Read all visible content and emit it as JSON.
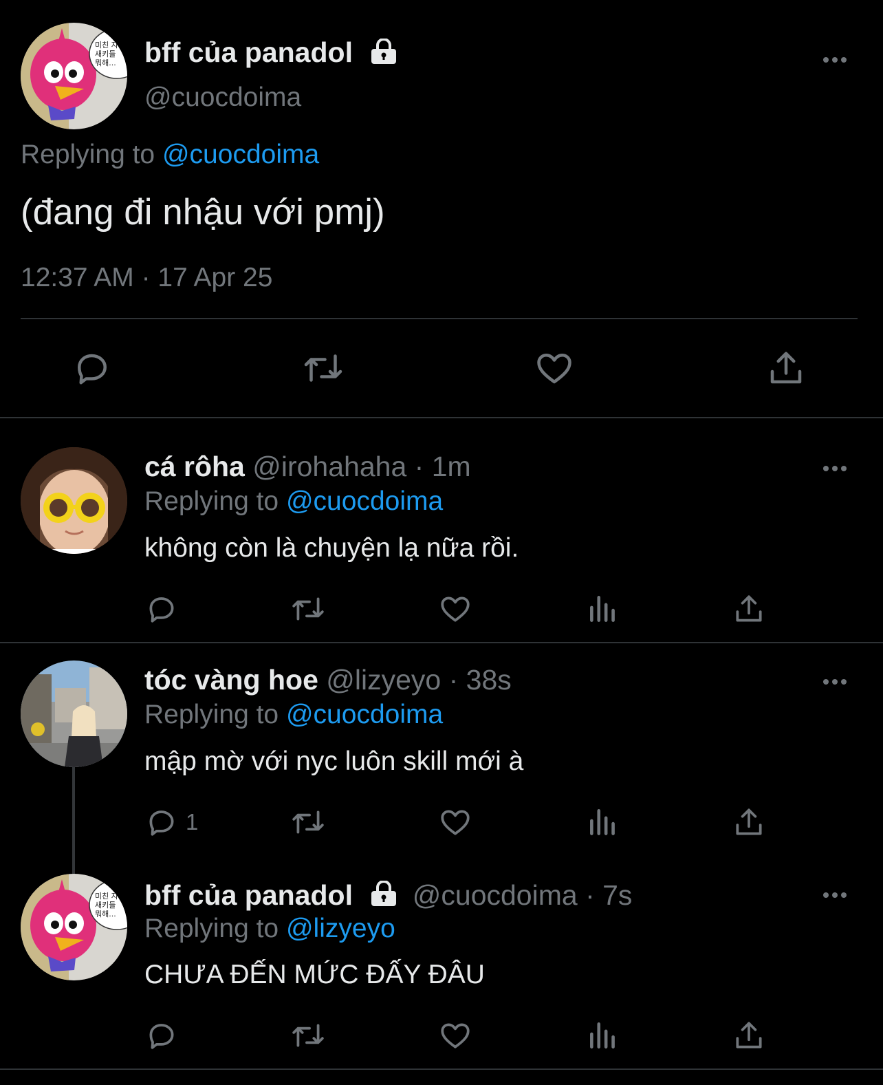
{
  "main_tweet": {
    "author_name": "bff của panadol",
    "author_handle": "@cuocdoima",
    "replying_prefix": "Replying to",
    "replying_to": "@cuocdoima",
    "text": "(đang đi nhậu với pmj)",
    "timestamp": "12:37 AM · 17 Apr 25",
    "avatar_speech_text": "미친 자\n새키들\n뭐해..."
  },
  "replies": [
    {
      "author_name": "cá rôha",
      "author_handle": "@irohahaha",
      "time": "1m",
      "replying_prefix": "Replying to",
      "replying_to": "@cuocdoima",
      "text": "không còn là chuyện lạ nữa rồi.",
      "reply_count": ""
    },
    {
      "author_name": "tóc vàng hoe",
      "author_handle": "@lizyeyo",
      "time": "38s",
      "replying_prefix": "Replying to",
      "replying_to": "@cuocdoima",
      "text": "mập mờ với nyc luôn skill mới à",
      "reply_count": "1"
    },
    {
      "author_name": "bff của panadol",
      "author_handle": "@cuocdoima",
      "time": "7s",
      "replying_prefix": "Replying to",
      "replying_to": "@lizyeyo",
      "text": "CHƯA ĐẾN MỨC ĐẤY ĐÂU",
      "reply_count": ""
    }
  ],
  "separator": " · ",
  "colors": {
    "background": "#000000",
    "text": "#e7e9ea",
    "muted": "#71767b",
    "accent": "#1d9bf0",
    "divider": "#2f3336"
  },
  "icons": [
    "reply-icon",
    "retweet-icon",
    "like-icon",
    "views-icon",
    "share-icon",
    "more-icon",
    "lock-icon"
  ]
}
